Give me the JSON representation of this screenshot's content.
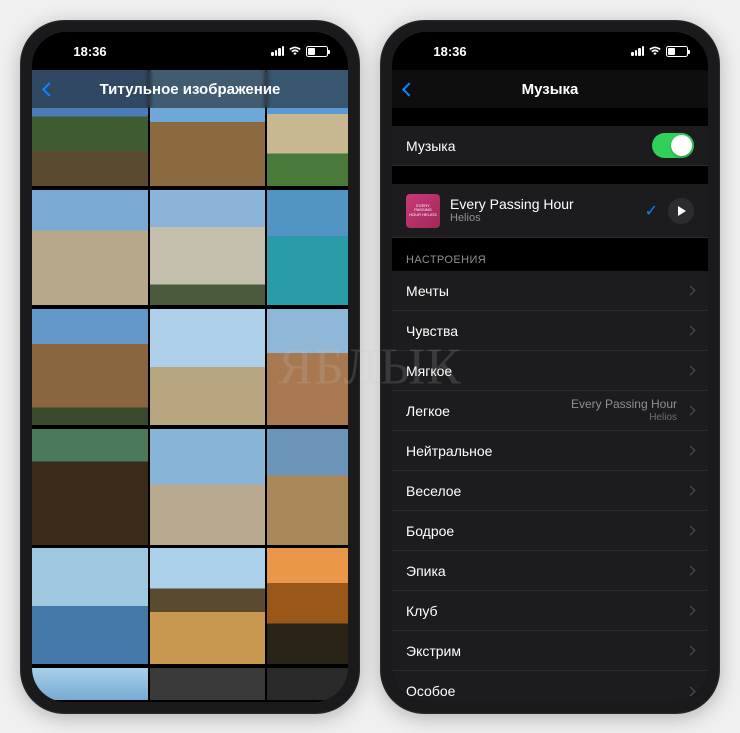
{
  "watermark": "ЯБЛЫК",
  "statusbar": {
    "time": "18:36"
  },
  "left": {
    "title": "Титульное изображение",
    "selected_index": 2
  },
  "right": {
    "title": "Музыка",
    "music_toggle_label": "Музыка",
    "music_toggle_on": true,
    "current_song": {
      "title": "Every Passing Hour",
      "artist": "Helios",
      "art_text": "EVERY PASSING HOUR HELIOS"
    },
    "section_header": "НАСТРОЕНИЯ",
    "moods": [
      {
        "label": "Мечты"
      },
      {
        "label": "Чувства"
      },
      {
        "label": "Мягкое"
      },
      {
        "label": "Легкое",
        "detail_title": "Every Passing Hour",
        "detail_sub": "Helios"
      },
      {
        "label": "Нейтральное"
      },
      {
        "label": "Веселое"
      },
      {
        "label": "Бодрое"
      },
      {
        "label": "Эпика"
      },
      {
        "label": "Клуб"
      },
      {
        "label": "Экстрим"
      },
      {
        "label": "Особое"
      }
    ]
  }
}
